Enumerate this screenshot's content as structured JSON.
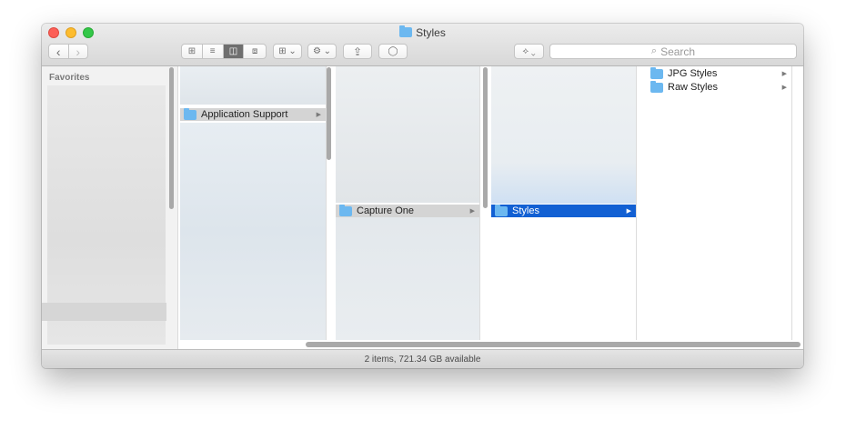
{
  "window": {
    "title": "Styles"
  },
  "toolbar": {
    "back": "‹",
    "forward": "›",
    "view_icon": "⊞",
    "view_list": "≡",
    "view_column": "◫",
    "view_gallery": "⧈",
    "arrange": "⊞ ⌄",
    "action": "⚙ ⌄",
    "share": "⇪",
    "tags": "◯",
    "dropbox": "⟡ ⌄",
    "search_placeholder": "Search",
    "search_glyph": "⌕"
  },
  "sidebar": {
    "heading": "Favorites"
  },
  "columns": [
    {
      "items": [
        {
          "label": "Application Support",
          "has_children": true,
          "selected": "inactive"
        }
      ]
    },
    {
      "items": [
        {
          "label": "Capture One",
          "has_children": true,
          "selected": "inactive"
        }
      ]
    },
    {
      "items": [
        {
          "label": "Styles",
          "has_children": true,
          "selected": "active"
        }
      ]
    },
    {
      "items": [
        {
          "label": "JPG Styles",
          "has_children": true,
          "selected": "none"
        },
        {
          "label": "Raw Styles",
          "has_children": true,
          "selected": "none"
        }
      ]
    }
  ],
  "chevron": "▶",
  "status": {
    "text": "2 items, 721.34 GB available"
  },
  "colors": {
    "selection_blue": "#1260d3",
    "folder": "#6cb8f0"
  }
}
